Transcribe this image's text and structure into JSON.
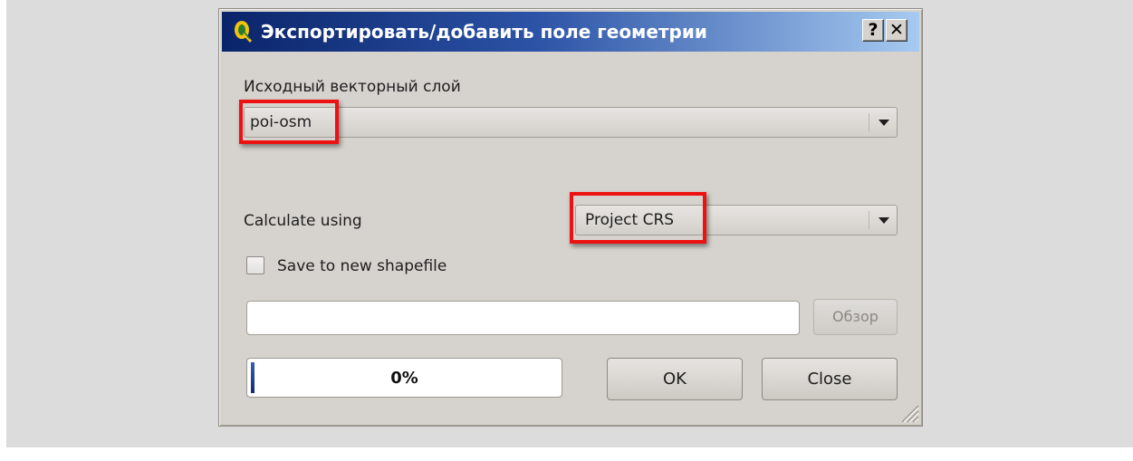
{
  "dialog": {
    "title": "Экспортировать/добавить поле геометрии",
    "help_label": "?",
    "close_label": "✕"
  },
  "source_layer": {
    "label": "Исходный векторный слой",
    "value": "poi-osm"
  },
  "calculate": {
    "label": "Calculate using",
    "value": "Project CRS"
  },
  "save_option": {
    "label": "Save to new shapefile",
    "checked": false
  },
  "output_path": {
    "value": "",
    "browse_label": "Обзор"
  },
  "progress": {
    "percent": 0,
    "text": "0%"
  },
  "buttons": {
    "ok": "OK",
    "close": "Close"
  },
  "colors": {
    "highlight": "#ee1111",
    "title_bar": "#0a246a",
    "dialog_bg": "#d6d3ce"
  },
  "icons": [
    "qgis-logo-icon",
    "help-icon",
    "close-icon",
    "dropdown-arrow-icon",
    "resize-grip-icon"
  ]
}
